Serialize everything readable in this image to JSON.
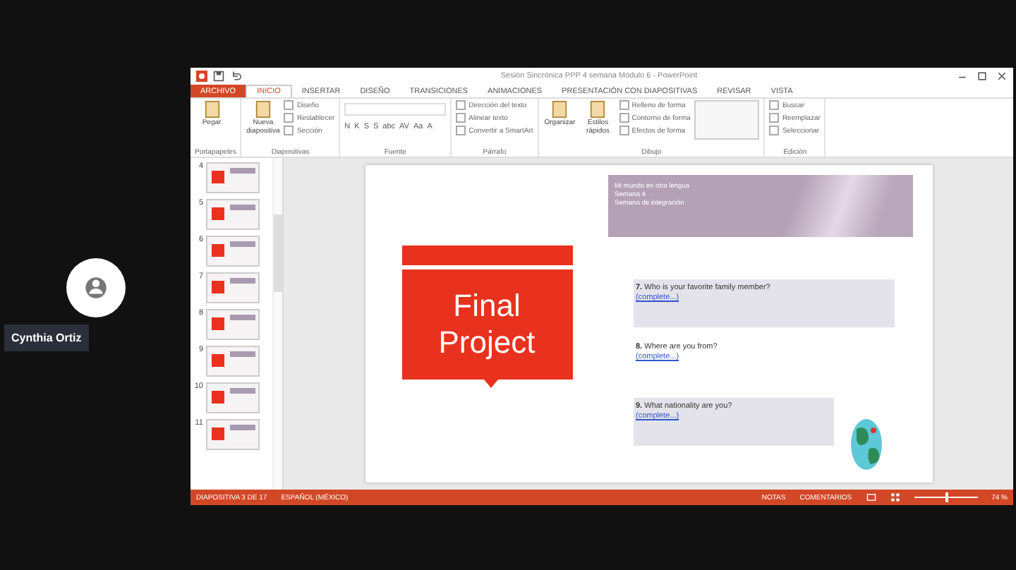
{
  "participant": {
    "name": "Cynthia Ortiz"
  },
  "window": {
    "title": "Sesión Sincrónica PPP 4 semana Módulo 6 - PowerPoint"
  },
  "tabs": [
    {
      "label": "ARCHIVO",
      "kind": "file",
      "selected": false
    },
    {
      "label": "INICIO",
      "kind": "tab",
      "selected": true
    },
    {
      "label": "INSERTAR",
      "kind": "tab",
      "selected": false
    },
    {
      "label": "DISEÑO",
      "kind": "tab",
      "selected": false
    },
    {
      "label": "TRANSICIONES",
      "kind": "tab",
      "selected": false
    },
    {
      "label": "ANIMACIONES",
      "kind": "tab",
      "selected": false
    },
    {
      "label": "PRESENTACIÓN CON DIAPOSITIVAS",
      "kind": "tab",
      "selected": false
    },
    {
      "label": "REVISAR",
      "kind": "tab",
      "selected": false
    },
    {
      "label": "VISTA",
      "kind": "tab",
      "selected": false
    }
  ],
  "ribbon": {
    "groups": [
      {
        "name": "Portapapeles",
        "big": [
          "Pegar"
        ]
      },
      {
        "name": "Diapositivas",
        "big": [
          "Nueva diapositiva"
        ],
        "small": [
          "Diseño",
          "Restablecer",
          "Sección"
        ]
      },
      {
        "name": "Fuente",
        "font_buttons": [
          "N",
          "K",
          "S",
          "S",
          "abc",
          "AV",
          "Aa",
          "A"
        ]
      },
      {
        "name": "Párrafo",
        "small": [
          "Dirección del texto",
          "Alinear texto",
          "Convertir a SmartArt"
        ]
      },
      {
        "name": "Dibujo",
        "big": [
          "Organizar",
          "Estilos rápidos"
        ],
        "small": [
          "Relleno de forma",
          "Contorno de forma",
          "Efectos de forma"
        ]
      },
      {
        "name": "Edición",
        "small": [
          "Buscar",
          "Reemplazar",
          "Seleccionar"
        ]
      }
    ]
  },
  "thumbnails": [
    {
      "number": "4"
    },
    {
      "number": "5"
    },
    {
      "number": "6"
    },
    {
      "number": "7"
    },
    {
      "number": "8"
    },
    {
      "number": "9"
    },
    {
      "number": "10"
    },
    {
      "number": "11"
    }
  ],
  "slide": {
    "header": [
      "Mi mundo en otra lengua",
      "Semana 4",
      "Semana de integración"
    ],
    "title": "Final Project",
    "questions": [
      {
        "text": "**7.** Who is your favorite family member?",
        "link": "(complete...)",
        "shaded": true
      },
      {
        "text": "**8.** Where are you from?",
        "link": "(complete...)",
        "shaded": false
      },
      {
        "text": "**9.** What nationality are you?",
        "link": "(complete...)",
        "shaded": true
      }
    ]
  },
  "status_bar": {
    "slide": "DIAPOSITIVA 3 DE 17",
    "language": "ESPAÑOL (MÉXICO)",
    "notes": "NOTAS",
    "comments": "COMENTARIOS",
    "zoom": "74 %",
    "level": 0.5
  }
}
